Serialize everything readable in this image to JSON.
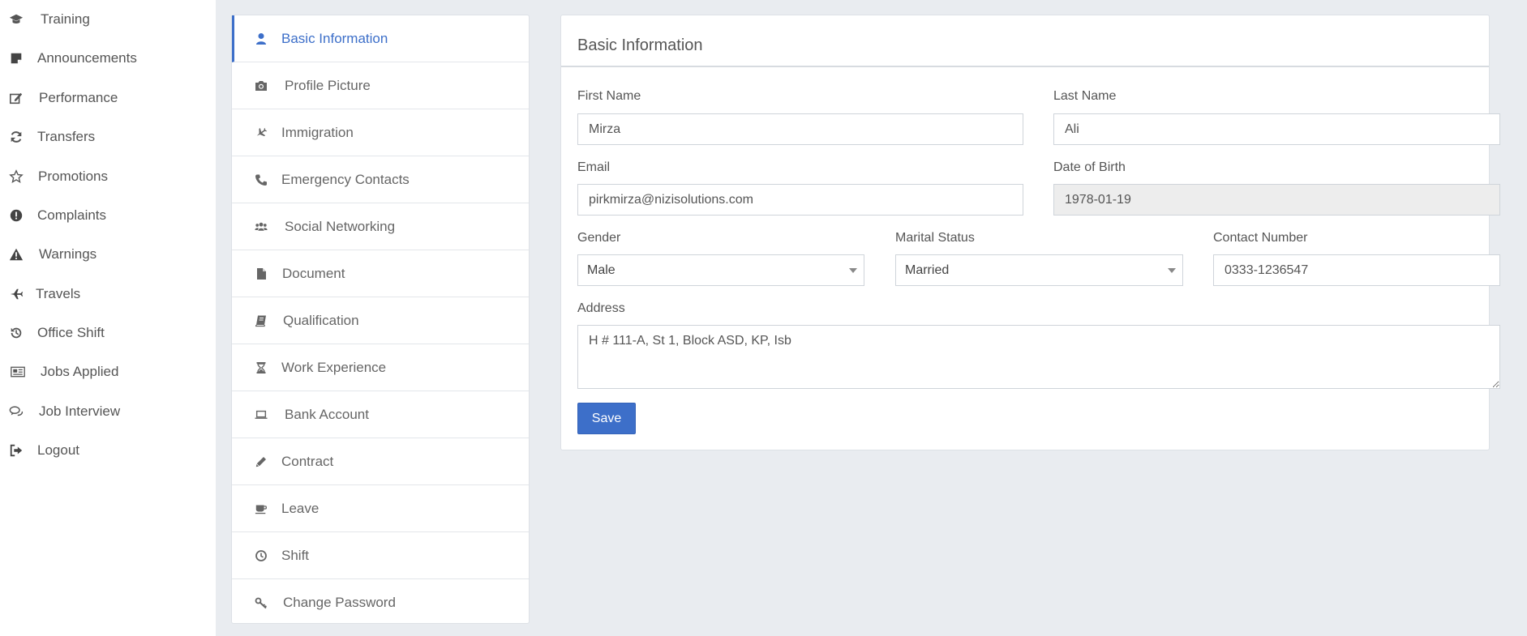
{
  "sidebar": {
    "items": [
      {
        "label": "Training",
        "icon": "graduation-cap-icon"
      },
      {
        "label": "Announcements",
        "icon": "sticky-note-icon"
      },
      {
        "label": "Performance",
        "icon": "edit-icon"
      },
      {
        "label": "Transfers",
        "icon": "refresh-icon"
      },
      {
        "label": "Promotions",
        "icon": "star-icon"
      },
      {
        "label": "Complaints",
        "icon": "exclamation-circle-icon"
      },
      {
        "label": "Warnings",
        "icon": "warning-icon"
      },
      {
        "label": "Travels",
        "icon": "plane-icon"
      },
      {
        "label": "Office Shift",
        "icon": "history-icon"
      },
      {
        "label": "Jobs Applied",
        "icon": "newspaper-icon"
      },
      {
        "label": "Job Interview",
        "icon": "comments-icon"
      },
      {
        "label": "Logout",
        "icon": "sign-out-icon"
      }
    ]
  },
  "subnav": {
    "items": [
      {
        "label": "Basic Information",
        "icon": "user-icon",
        "active": true
      },
      {
        "label": "Profile Picture",
        "icon": "camera-icon"
      },
      {
        "label": "Immigration",
        "icon": "plane-icon"
      },
      {
        "label": "Emergency Contacts",
        "icon": "phone-icon"
      },
      {
        "label": "Social Networking",
        "icon": "users-icon"
      },
      {
        "label": "Document",
        "icon": "file-icon"
      },
      {
        "label": "Qualification",
        "icon": "book-icon"
      },
      {
        "label": "Work Experience",
        "icon": "hourglass-icon"
      },
      {
        "label": "Bank Account",
        "icon": "laptop-icon"
      },
      {
        "label": "Contract",
        "icon": "pencil-icon"
      },
      {
        "label": "Leave",
        "icon": "coffee-icon"
      },
      {
        "label": "Shift",
        "icon": "clock-icon"
      },
      {
        "label": "Change Password",
        "icon": "key-icon"
      }
    ]
  },
  "form": {
    "title": "Basic Information",
    "first_name": {
      "label": "First Name",
      "value": "Mirza"
    },
    "last_name": {
      "label": "Last Name",
      "value": "Ali"
    },
    "email": {
      "label": "Email",
      "value": "pirkmirza@nizisolutions.com"
    },
    "dob": {
      "label": "Date of Birth",
      "value": "1978-01-19"
    },
    "gender": {
      "label": "Gender",
      "value": "Male"
    },
    "marital_status": {
      "label": "Marital Status",
      "value": "Married"
    },
    "contact_number": {
      "label": "Contact Number",
      "value": "0333-1236547"
    },
    "address": {
      "label": "Address",
      "value": "H # 111-A, St 1, Block ASD, KP, Isb"
    },
    "save_label": "Save"
  },
  "colors": {
    "accent": "#3d6fc9",
    "background": "#e9ecf0"
  }
}
